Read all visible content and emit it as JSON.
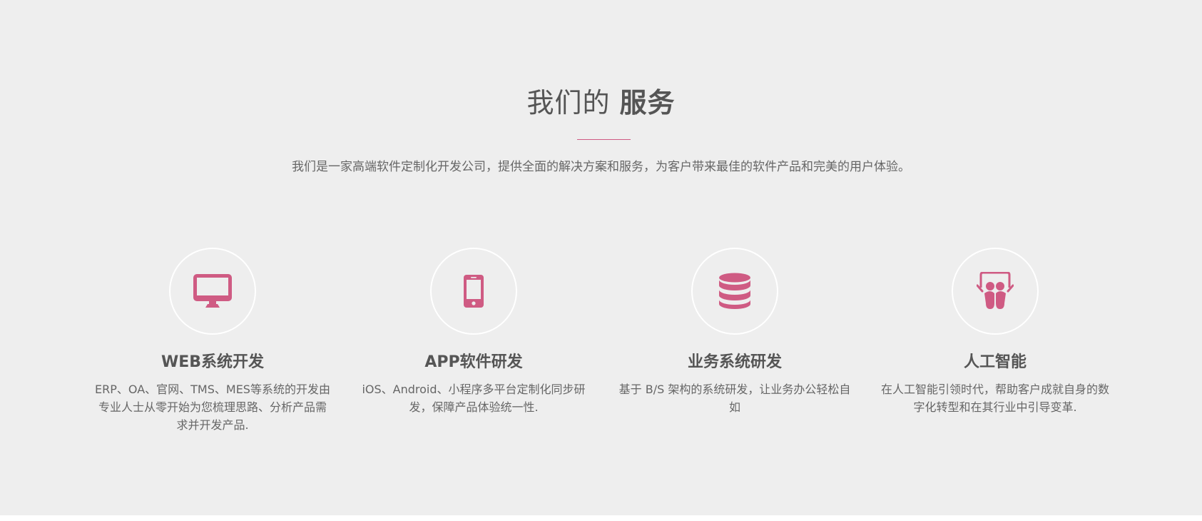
{
  "section": {
    "title_regular": "我们的",
    "title_bold": "服务",
    "intro": "我们是一家高端软件定制化开发公司，提供全面的解决方案和服务，为客户带来最佳的软件产品和完美的用户体验。"
  },
  "colors": {
    "accent": "#cf5b83",
    "background": "#eeeeee",
    "text": "#555555"
  },
  "services": [
    {
      "icon": "monitor-icon",
      "title": "WEB系统开发",
      "description": "ERP、OA、官网、TMS、MES等系统的开发由专业人士从零开始为您梳理思路、分析产品需求并开发产品."
    },
    {
      "icon": "mobile-phone-icon",
      "title": "APP软件研发",
      "description": "iOS、Android、小程序多平台定制化同步研发，保障产品体验统一性."
    },
    {
      "icon": "database-icon",
      "title": "业务系统研发",
      "description": "基于 B/S 架构的系统研发，让业务办公轻松自如"
    },
    {
      "icon": "presentation-board-icon",
      "title": "人工智能",
      "description": "在人工智能引领时代，帮助客户成就自身的数字化转型和在其行业中引导变革."
    }
  ]
}
